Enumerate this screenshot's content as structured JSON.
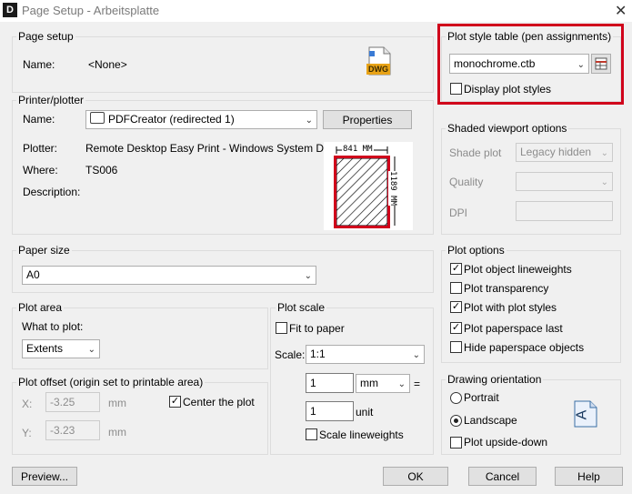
{
  "window": {
    "title": "Page Setup - Arbeitsplatte",
    "app_icon": "D",
    "close_glyph": "✕"
  },
  "page_setup": {
    "legend": "Page setup",
    "name_label": "Name:",
    "name_value": "<None>",
    "dwg_badge": "DWG"
  },
  "printer": {
    "legend": "Printer/plotter",
    "name_label": "Name:",
    "name_value": "PDFCreator (redirected 1)",
    "properties_button": "Properties",
    "plotter_label": "Plotter:",
    "plotter_value": "Remote Desktop Easy Print - Windows System Driv...",
    "where_label": "Where:",
    "where_value": "TS006",
    "description_label": "Description:",
    "preview_width": "841 MM",
    "preview_height": "1189 MM"
  },
  "paper_size": {
    "legend": "Paper size",
    "value": "A0"
  },
  "plot_area": {
    "legend": "Plot area",
    "what_label": "What to plot:",
    "what_value": "Extents"
  },
  "plot_offset": {
    "legend": "Plot offset (origin set to printable area)",
    "x_label": "X:",
    "x_value": "-3.25",
    "x_unit": "mm",
    "y_label": "Y:",
    "y_value": "-3.23",
    "y_unit": "mm",
    "center_label": "Center the plot",
    "center_checked": true
  },
  "plot_scale": {
    "legend": "Plot scale",
    "fit_label": "Fit to paper",
    "fit_checked": false,
    "scale_label": "Scale:",
    "scale_value": "1:1",
    "value1": "1",
    "unit1": "mm",
    "equals": "=",
    "value2": "1",
    "unit2": "unit",
    "lineweights_label": "Scale lineweights",
    "lineweights_checked": false
  },
  "plot_style": {
    "legend": "Plot style table (pen assignments)",
    "value": "monochrome.ctb",
    "display_label": "Display plot styles",
    "display_checked": false
  },
  "shaded": {
    "legend": "Shaded viewport options",
    "shade_label": "Shade plot",
    "shade_value": "Legacy hidden",
    "quality_label": "Quality",
    "quality_value": "",
    "dpi_label": "DPI",
    "dpi_value": ""
  },
  "plot_options": {
    "legend": "Plot options",
    "items": [
      {
        "label": "Plot object lineweights",
        "checked": true
      },
      {
        "label": "Plot transparency",
        "checked": false
      },
      {
        "label": "Plot with plot styles",
        "checked": true
      },
      {
        "label": "Plot paperspace last",
        "checked": true
      },
      {
        "label": "Hide paperspace objects",
        "checked": false
      }
    ]
  },
  "orientation": {
    "legend": "Drawing orientation",
    "portrait_label": "Portrait",
    "portrait_selected": false,
    "landscape_label": "Landscape",
    "landscape_selected": true,
    "upside_label": "Plot upside-down",
    "upside_checked": false,
    "icon_letter": "A"
  },
  "buttons": {
    "preview": "Preview...",
    "ok": "OK",
    "cancel": "Cancel",
    "help": "Help"
  },
  "colors": {
    "highlight": "#d0021b",
    "check": "✓",
    "chevron": "⌄"
  }
}
